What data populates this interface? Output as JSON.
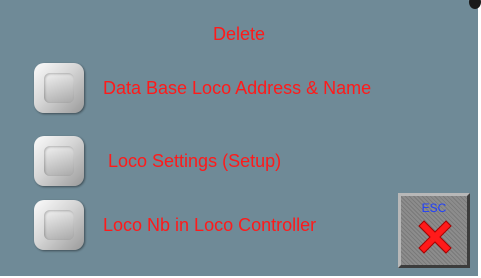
{
  "dialog": {
    "title": "Delete"
  },
  "options": [
    {
      "label": "Data Base Loco Address & Name"
    },
    {
      "label": "Loco Settings (Setup)"
    },
    {
      "label": "Loco Nb in Loco Controller"
    }
  ],
  "esc_button": {
    "label": "ESC",
    "icon": "close-icon",
    "icon_color": "#ff1a1a"
  },
  "colors": {
    "background": "#6f8a97",
    "text": "#ff1a1a",
    "esc_label": "#1f3fff"
  }
}
